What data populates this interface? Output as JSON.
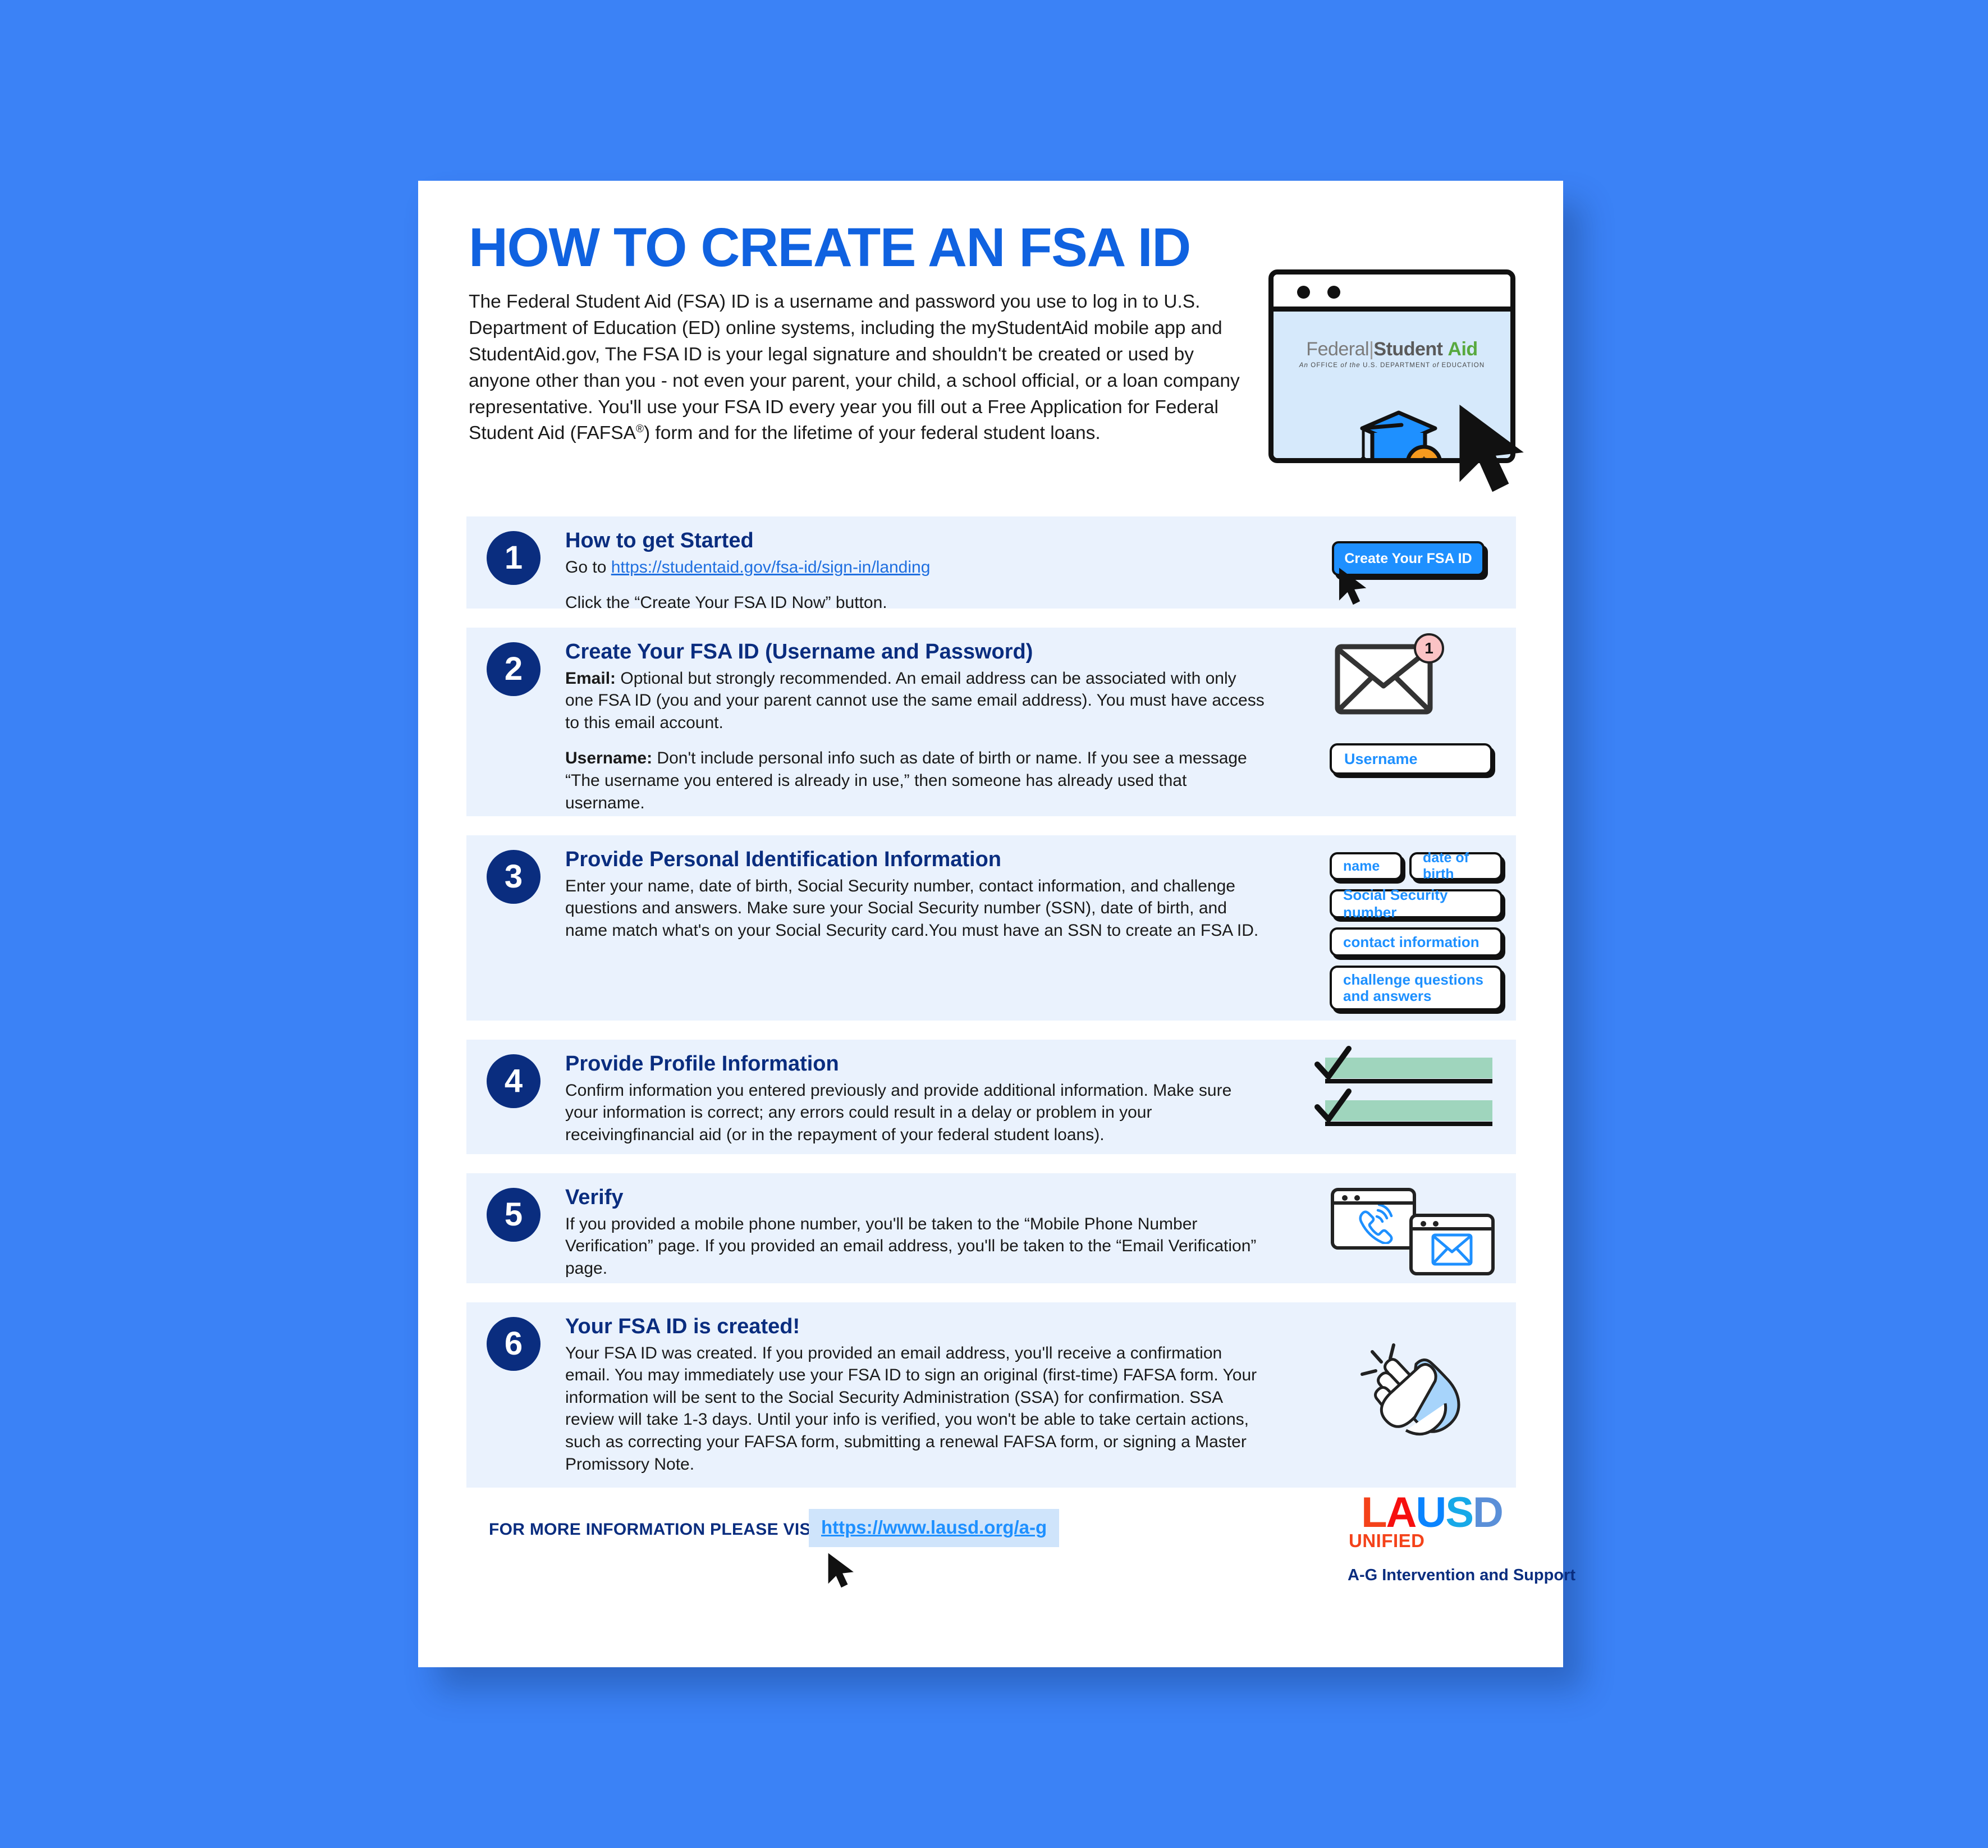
{
  "page": {
    "background_color": "#3b82f6",
    "sheet_color": "#ffffff",
    "card_color": "#eaf2fd",
    "navy": "#0a2d7f",
    "accent_blue": "#1e90ff"
  },
  "header": {
    "title": "HOW TO CREATE AN FSA ID",
    "intro": "The Federal Student Aid (FSA) ID is a username and password you use to log in to U.S. Department of Education (ED) online systems, including the myStudentAid mobile app and StudentAid.gov, The FSA ID is your legal signature and shouldn't be created or used by anyone other than you - not even your parent, your child, a school official, or a loan company representative. You'll use your FSA ID every year you fill out a Free Application for Federal Student Aid (FAFSA",
    "intro_sup": "®",
    "intro_tail": ") form and for the lifetime of your federal student loans.",
    "hero": {
      "logo_federal": "Federal",
      "logo_bar": "|",
      "logo_student": "Student",
      "logo_aid": "Aid",
      "logo_sub_pre": "An",
      "logo_sub_1": " OFFICE ",
      "logo_sub_of": "of",
      "logo_sub_2": " the ",
      "logo_sub_3": "U.S. DEPARTMENT ",
      "logo_sub_of2": "of",
      "logo_sub_4": " EDUCATION"
    }
  },
  "steps": [
    {
      "number": "1",
      "heading": "How to get Started",
      "line_prefix": "Go to ",
      "link": "https://studentaid.gov/fsa-id/sign-in/landing",
      "line_after": "Click the “Create Your FSA ID Now” button.",
      "button_label": "Create Your FSA ID"
    },
    {
      "number": "2",
      "heading": "Create Your FSA ID (Username and Password)",
      "p1_bold": "Email:",
      "p1": " Optional but strongly recommended. An email address can be associated with only one FSA ID (you and your parent cannot use the same email address). You must have access to this email account.",
      "p2_bold": "Username:",
      "p2": " Don't include personal info such as date of birth or name. If you see a message “The username you entered is already in use,” then someone has already used that username.",
      "badge_count": "1",
      "username_field": "Username"
    },
    {
      "number": "3",
      "heading": "Provide Personal Identification Information",
      "p1": "Enter your name, date of birth, Social Security number, contact information, and challenge questions and answers. Make sure your Social Security number (SSN), date of birth, and name match what's on your Social Security card.You must have an SSN to create an FSA ID.",
      "pills": [
        "name",
        "date of birth",
        "Social Security number",
        "contact information",
        "challenge questions and answers"
      ]
    },
    {
      "number": "4",
      "heading": "Provide Profile Information",
      "p1": "Confirm information you entered previously and provide additional information. Make sure your information is correct; any errors could result in a delay or problem in your receivingfinancial aid (or in the repayment of your federal student loans)."
    },
    {
      "number": "5",
      "heading": "Verify",
      "p1": "If you provided a mobile phone number, you'll be taken to the “Mobile Phone Number Verification” page. If you provided an email address, you'll be taken to the “Email Verification” page."
    },
    {
      "number": "6",
      "heading": "Your FSA ID is created!",
      "p1": "Your FSA ID was created. If you provided an email address, you'll receive a confirmation email. You may immediately use your FSA ID to sign an original (first-time) FAFSA form. Your information will be sent to the Social Security Administration (SSA) for confirmation. SSA review will take 1-3 days. Until your info is verified, you won't be able to take certain actions, such as correcting your FAFSA form, submitting a renewal FAFSA form, or signing a Master Promissory Note."
    }
  ],
  "footer": {
    "more_info_label": "FOR MORE INFORMATION PLEASE VISIT:",
    "link": "https://www.lausd.org/a-g",
    "logo": {
      "l": "L",
      "a": "A",
      "u": "U",
      "s": "S",
      "d": "D",
      "unified": "UNIFIED",
      "tagline": "A-G Intervention and Support"
    }
  }
}
